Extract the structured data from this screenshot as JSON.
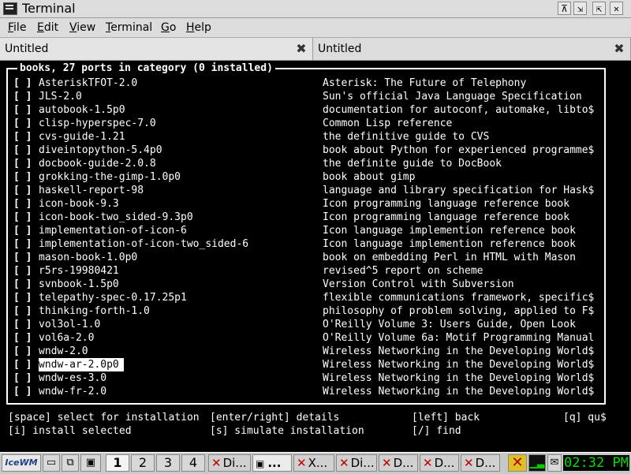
{
  "window": {
    "title": "Terminal"
  },
  "menu": [
    {
      "label": "File",
      "u": "F",
      "rest": "ile"
    },
    {
      "label": "Edit",
      "u": "E",
      "rest": "dit"
    },
    {
      "label": "View",
      "u": "V",
      "rest": "iew"
    },
    {
      "label": "Terminal",
      "u": "T",
      "rest": "erminal"
    },
    {
      "label": "Go",
      "u": "G",
      "rest": "o"
    },
    {
      "label": "Help",
      "u": "H",
      "rest": "elp"
    }
  ],
  "tabs": [
    {
      "label": "Untitled"
    },
    {
      "label": "Untitled"
    }
  ],
  "terminal": {
    "box_title": "books, 27 ports in category (0 installed)",
    "checkbox": "[ ]",
    "entries": [
      {
        "name": "AsteriskTFOT-2.0",
        "desc": "Asterisk: The Future of Telephony"
      },
      {
        "name": "JLS-2.0",
        "desc": "Sun's official Java Language Specification"
      },
      {
        "name": "autobook-1.5p0",
        "desc": "documentation for autoconf, automake, libto$"
      },
      {
        "name": "clisp-hyperspec-7.0",
        "desc": "Common Lisp reference"
      },
      {
        "name": "cvs-guide-1.21",
        "desc": "the definitive guide to CVS"
      },
      {
        "name": "diveintopython-5.4p0",
        "desc": "book about Python for experienced programme$"
      },
      {
        "name": "docbook-guide-2.0.8",
        "desc": "the definite guide to DocBook"
      },
      {
        "name": "grokking-the-gimp-1.0p0",
        "desc": "book about gimp"
      },
      {
        "name": "haskell-report-98",
        "desc": "language and library specification for Hask$"
      },
      {
        "name": "icon-book-9.3",
        "desc": "Icon programming language reference book"
      },
      {
        "name": "icon-book-two_sided-9.3p0",
        "desc": "Icon programming language reference book"
      },
      {
        "name": "implementation-of-icon-6",
        "desc": "Icon language implemention reference book"
      },
      {
        "name": "implementation-of-icon-two_sided-6",
        "desc": "Icon language implemention reference book"
      },
      {
        "name": "mason-book-1.0p0",
        "desc": "book on embedding Perl in HTML with Mason"
      },
      {
        "name": "r5rs-19980421",
        "desc": "revised^5 report on scheme"
      },
      {
        "name": "svnbook-1.5p0",
        "desc": "Version Control with Subversion"
      },
      {
        "name": "telepathy-spec-0.17.25p1",
        "desc": "flexible communications framework, specific$"
      },
      {
        "name": "thinking-forth-1.0",
        "desc": "philosophy of problem solving, applied to F$"
      },
      {
        "name": "vol3ol-1.0",
        "desc": "O'Reilly Volume 3: Users Guide, Open Look"
      },
      {
        "name": "vol6a-2.0",
        "desc": "O'Reilly Volume 6a: Motif Programming Manual"
      },
      {
        "name": "wndw-2.0",
        "desc": "Wireless Networking in the Developing World$"
      },
      {
        "name": "wndw-ar-2.0p0",
        "desc": "Wireless Networking in the Developing World$"
      },
      {
        "name": "wndw-es-3.0",
        "desc": "Wireless Networking in the Developing World$"
      },
      {
        "name": "wndw-fr-2.0",
        "desc": "Wireless Networking in the Developing World$"
      }
    ],
    "selected_index": 21,
    "help": {
      "space": "[space] select for installation",
      "enter": "[enter/right] details",
      "left": "[left] back",
      "quit": "[q] qu$",
      "install": "[i] install selected",
      "simulate": "[s] simulate installation",
      "find": "[/] find"
    }
  },
  "taskbar": {
    "start_label": "IceWM",
    "workspaces": [
      "1",
      "2",
      "3",
      "4"
    ],
    "active_workspace": "1",
    "tasks": [
      "Di...",
      "...",
      "X...",
      "Di...",
      "D...",
      "D...",
      "D...",
      "D..."
    ],
    "clock": "02:32 PM"
  },
  "icons": {
    "app": "terminal-icon",
    "close_tab": "close-icon",
    "window_buttons": [
      "minimize-icon",
      "maximize-icon",
      "restore-icon",
      "close-icon"
    ]
  }
}
